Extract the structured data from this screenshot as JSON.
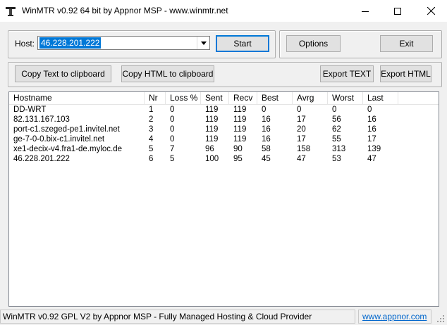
{
  "window": {
    "title": "WinMTR v0.92 64 bit by Appnor MSP - www.winmtr.net"
  },
  "host": {
    "label": "Host:",
    "value": "46.228.201.222"
  },
  "buttons": {
    "start": "Start",
    "options": "Options",
    "exit": "Exit",
    "copy_text": "Copy Text to clipboard",
    "copy_html": "Copy HTML to clipboard",
    "export_text": "Export TEXT",
    "export_html": "Export HTML"
  },
  "table": {
    "headers": [
      "Hostname",
      "Nr",
      "Loss %",
      "Sent",
      "Recv",
      "Best",
      "Avrg",
      "Worst",
      "Last"
    ],
    "rows": [
      [
        "DD-WRT",
        "1",
        "0",
        "119",
        "119",
        "0",
        "0",
        "0",
        "0"
      ],
      [
        "82.131.167.103",
        "2",
        "0",
        "119",
        "119",
        "16",
        "17",
        "56",
        "16"
      ],
      [
        "port-c1.szeged-pe1.invitel.net",
        "3",
        "0",
        "119",
        "119",
        "16",
        "20",
        "62",
        "16"
      ],
      [
        "ge-7-0-0.bix-c1.invitel.net",
        "4",
        "0",
        "119",
        "119",
        "16",
        "17",
        "55",
        "17"
      ],
      [
        "xe1-decix-v4.fra1-de.myloc.de",
        "5",
        "7",
        "96",
        "90",
        "58",
        "158",
        "313",
        "139"
      ],
      [
        "46.228.201.222",
        "6",
        "5",
        "100",
        "95",
        "45",
        "47",
        "53",
        "47"
      ]
    ]
  },
  "status": {
    "text": "WinMTR v0.92 GPL V2 by Appnor MSP - Fully Managed Hosting & Cloud Provider",
    "link": "www.appnor.com"
  },
  "icons": {
    "app": "app-icon",
    "minimize": "minimize-icon",
    "maximize": "maximize-icon",
    "close": "close-icon",
    "dropdown": "chevron-down-icon"
  },
  "colors": {
    "selection": "#0078d7",
    "link": "#0066cc"
  }
}
